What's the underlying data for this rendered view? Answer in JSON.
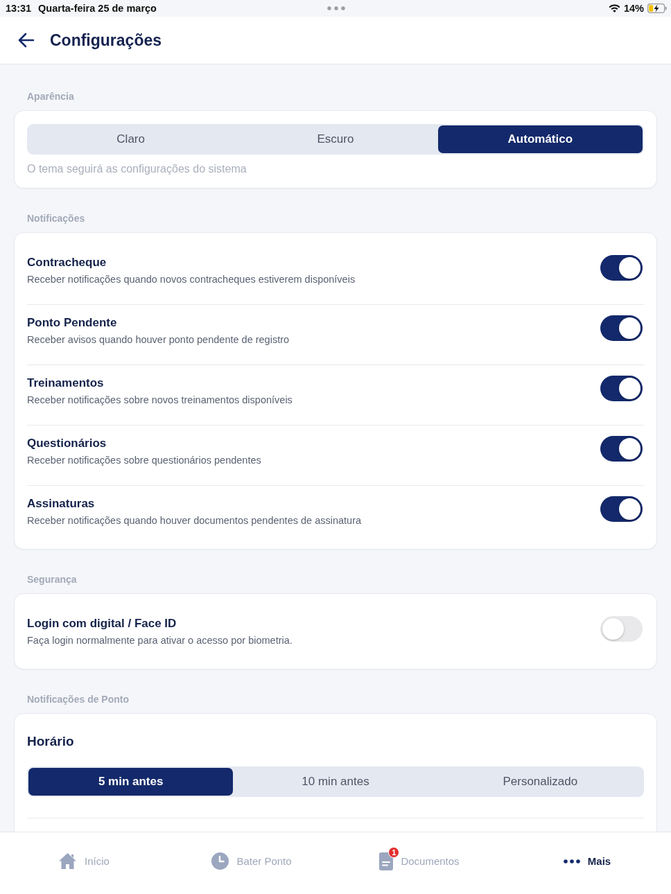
{
  "status_bar": {
    "time": "13:31",
    "date": "Quarta-feira 25 de março",
    "battery": "14%"
  },
  "header": {
    "title": "Configurações"
  },
  "sections": [
    {
      "kind": "segmented",
      "label": "Aparência",
      "options": [
        {
          "label": "Claro",
          "selected": false
        },
        {
          "label": "Escuro",
          "selected": false
        },
        {
          "label": "Automático",
          "selected": true
        }
      ],
      "hint": "O tema seguirá as configurações do sistema"
    },
    {
      "kind": "toggles",
      "label": "Notificações",
      "items": [
        {
          "title": "Contracheque",
          "description": "Receber notificações quando novos contracheques estiverem disponíveis",
          "on": true
        },
        {
          "title": "Ponto Pendente",
          "description": "Receber avisos quando houver ponto pendente de registro",
          "on": true
        },
        {
          "title": "Treinamentos",
          "description": "Receber notificações sobre novos treinamentos disponíveis",
          "on": true
        },
        {
          "title": "Questionários",
          "description": "Receber notificações sobre questionários pendentes",
          "on": true
        },
        {
          "title": "Assinaturas",
          "description": "Receber notificações quando houver documentos pendentes de assinatura",
          "on": true
        }
      ]
    },
    {
      "kind": "toggles",
      "label": "Segurança",
      "items": [
        {
          "title": "Login com digital / Face ID",
          "description": "Faça login normalmente para ativar o acesso por biometria.",
          "on": false
        }
      ]
    },
    {
      "kind": "segmented",
      "label": "Notificações de Ponto",
      "title": "Horário",
      "options": [
        {
          "label": "5 min antes",
          "selected": true
        },
        {
          "label": "10 min antes",
          "selected": false
        },
        {
          "label": "Personalizado",
          "selected": false
        }
      ]
    }
  ],
  "nav": [
    {
      "kind": "home",
      "label": "Início",
      "selected": false
    },
    {
      "kind": "clock",
      "label": "Bater Ponto",
      "selected": false
    },
    {
      "kind": "document",
      "label": "Documentos",
      "badge": "1",
      "selected": false
    },
    {
      "kind": "more",
      "label": "Mais",
      "selected": true
    }
  ]
}
